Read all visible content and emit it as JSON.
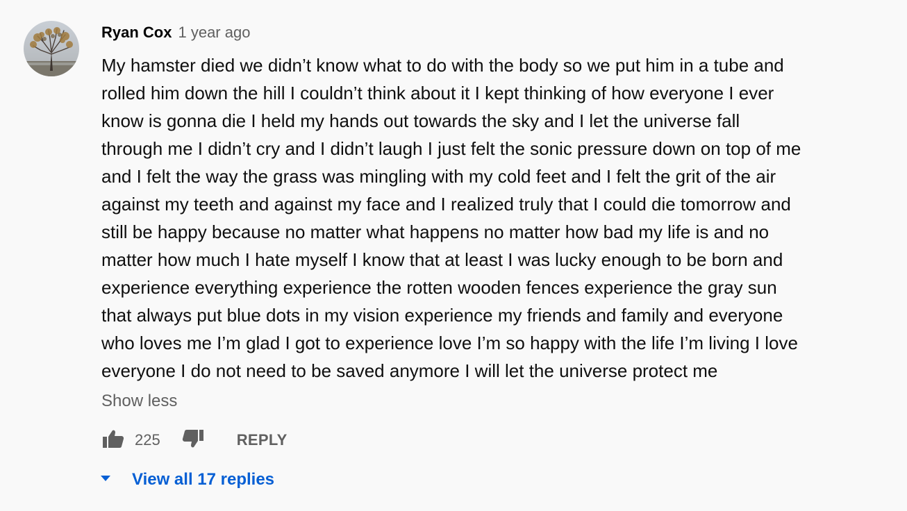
{
  "comment": {
    "author": "Ryan Cox",
    "timestamp": "1 year ago",
    "avatar_icon": "tree-photo-avatar",
    "text_lines": [
      "My hamster died we didn’t know what to do with the body so we put him in a tube and",
      "rolled him down the hill I couldn’t think about it I kept thinking of how everyone I ever",
      "know is gonna die I held my hands out towards the sky and I let the universe fall",
      "through me I didn’t cry and I didn’t laugh I just felt the sonic pressure down on top of me",
      "and I felt the way the grass was mingling with my cold feet and I felt the grit of the air",
      "against my teeth and against my face and I realized truly that I could die tomorrow and",
      "still be happy because no matter what happens no matter how bad my life is and no",
      "matter how much I hate myself I know that at least I was lucky enough to be born and",
      "experience everything experience the rotten wooden fences experience the gray sun",
      "that always put blue dots in my vision experience my friends and family and everyone",
      "who loves me I’m glad I got to experience love I’m so happy with the life I’m living I love",
      "everyone I do not need to be saved anymore I will let the universe protect me"
    ],
    "show_less_label": "Show less",
    "like_icon": "thumbs-up-icon",
    "like_count": "225",
    "dislike_icon": "thumbs-down-icon",
    "reply_label": "REPLY",
    "replies_icon": "caret-down-icon",
    "view_replies_label": "View all 17 replies"
  },
  "colors": {
    "background": "#f9f9f9",
    "text": "#0f0f0f",
    "secondary_text": "#606060",
    "link": "#065fd4"
  }
}
